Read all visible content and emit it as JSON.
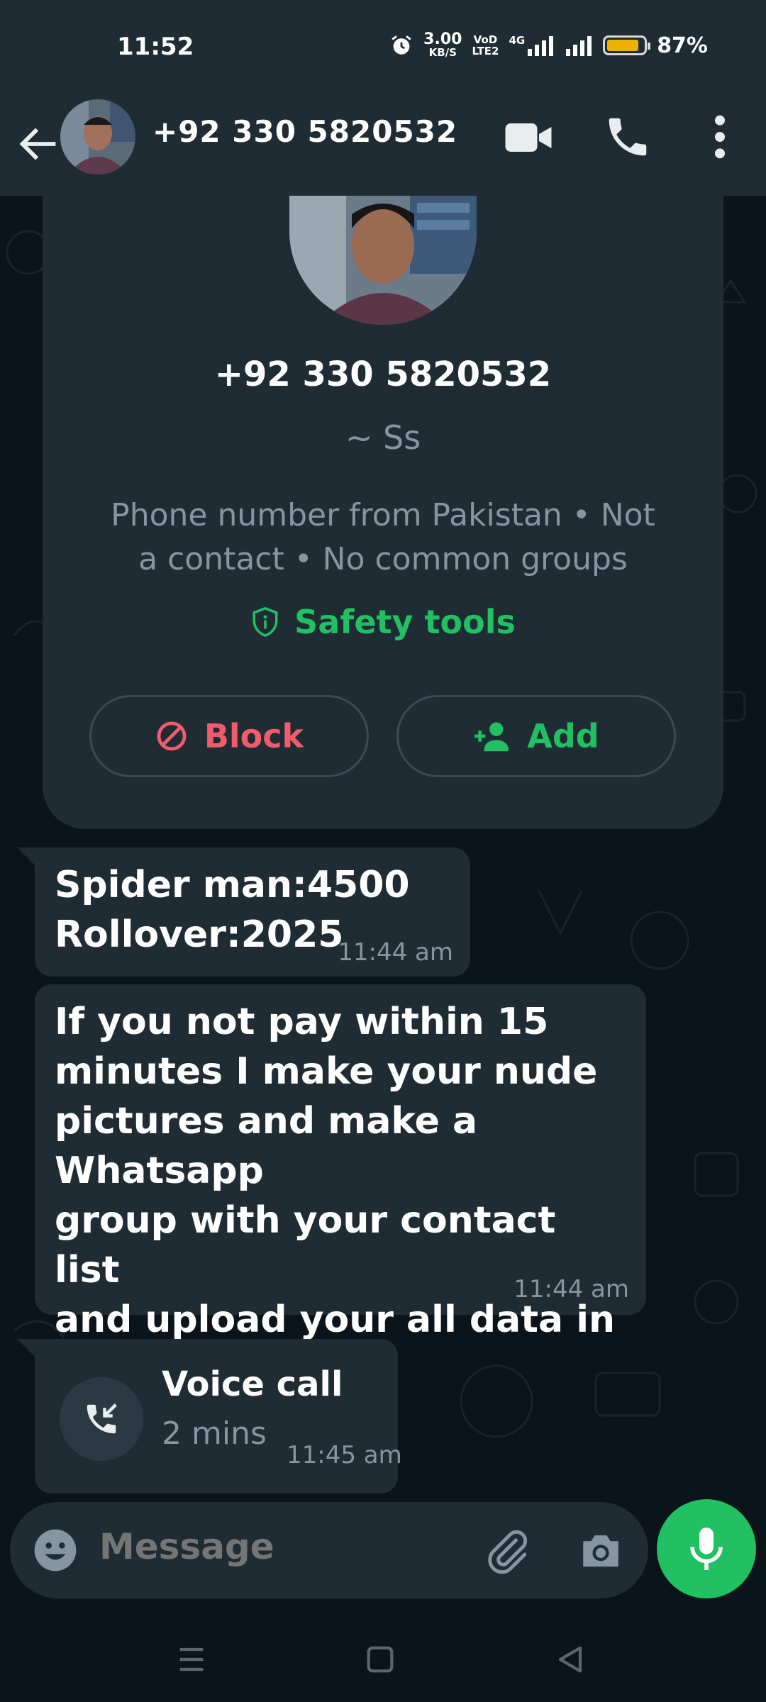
{
  "status_bar": {
    "time": "11:52",
    "net_speed_value": "3.00",
    "net_speed_unit": "KB/S",
    "volte_top": "VoD",
    "volte_bottom": "LTE2",
    "network_type": "4G",
    "battery_percent": "87%",
    "battery_level": 0.87
  },
  "header": {
    "contact_name": "+92 330 5820532"
  },
  "profile_card": {
    "number": "+92 330 5820532",
    "push_name": "~ Ss",
    "info": "Phone number from Pakistan • Not a contact • No common groups",
    "safety_tools_label": "Safety tools",
    "block_label": "Block",
    "add_label": "Add"
  },
  "messages": [
    {
      "text": "Spider man:4500\nRollover:2025",
      "time": "11:44 am"
    },
    {
      "text": "If you not pay within 15\nminutes I make  your  nude\npictures and make a Whatsapp\ngroup with your contact list\nand upload your all data in\nyour contact list",
      "time": "11:44 am"
    }
  ],
  "voice_call": {
    "title": "Voice call",
    "duration": "2 mins",
    "time": "11:45 am"
  },
  "composer": {
    "placeholder": "Message"
  },
  "colors": {
    "accent": "#21c063",
    "danger": "#f15c6d",
    "bubble": "#1f2c34",
    "header": "#202c33",
    "background": "#0b141a"
  }
}
